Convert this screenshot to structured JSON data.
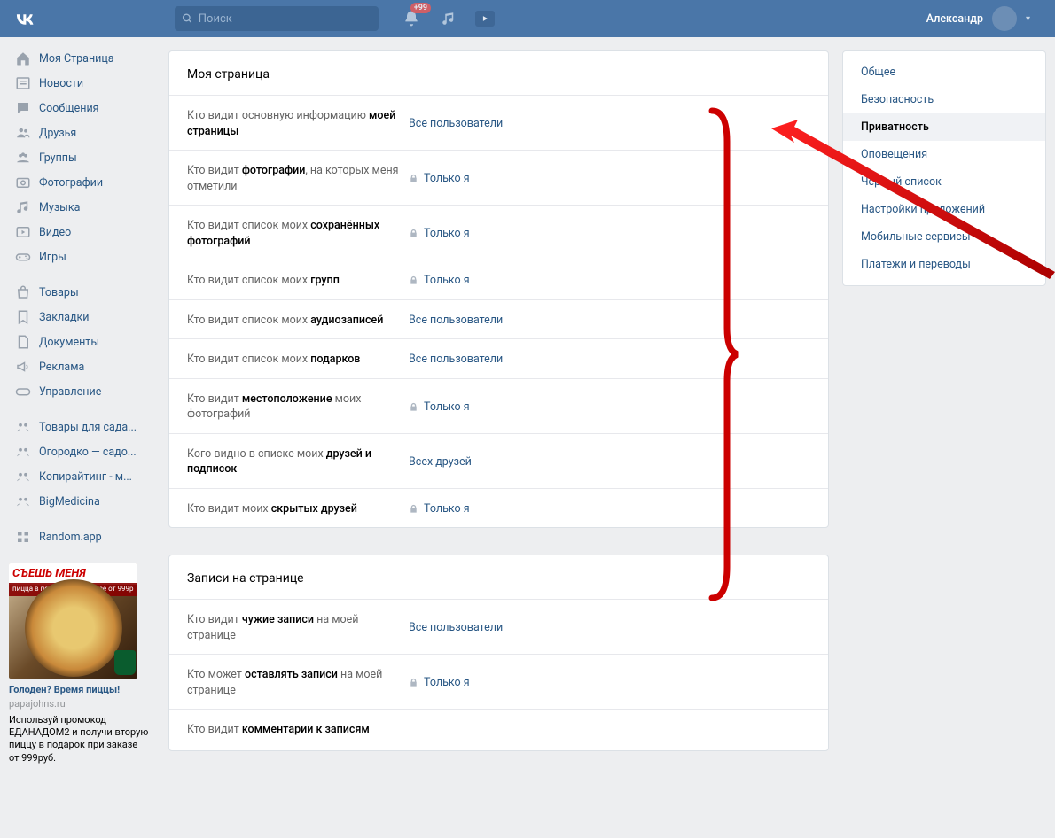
{
  "header": {
    "search_placeholder": "Поиск",
    "notif_badge": "+99",
    "username": "Александр"
  },
  "nav": [
    {
      "label": "Моя Страница",
      "icon": "home"
    },
    {
      "label": "Новости",
      "icon": "news"
    },
    {
      "label": "Сообщения",
      "icon": "chat"
    },
    {
      "label": "Друзья",
      "icon": "friends"
    },
    {
      "label": "Группы",
      "icon": "groups"
    },
    {
      "label": "Фотографии",
      "icon": "photo"
    },
    {
      "label": "Музыка",
      "icon": "music"
    },
    {
      "label": "Видео",
      "icon": "video"
    },
    {
      "label": "Игры",
      "icon": "games"
    },
    {
      "sep": true
    },
    {
      "label": "Товары",
      "icon": "market"
    },
    {
      "label": "Закладки",
      "icon": "bookmark"
    },
    {
      "label": "Документы",
      "icon": "doc"
    },
    {
      "label": "Реклама",
      "icon": "ads"
    },
    {
      "label": "Управление",
      "icon": "manage"
    },
    {
      "sep": true
    },
    {
      "label": "Товары для сада...",
      "icon": "ext"
    },
    {
      "label": "Огородко — садо...",
      "icon": "ext"
    },
    {
      "label": "Копирайтинг - м...",
      "icon": "ext"
    },
    {
      "label": "BigMedicina",
      "icon": "ext"
    },
    {
      "sep": true
    },
    {
      "label": "Random.app",
      "icon": "app"
    }
  ],
  "sections": [
    {
      "title": "Моя страница",
      "rows": [
        {
          "label": "Кто видит основную информацию <b>моей страницы</b>",
          "value": "Все пользователи",
          "lock": false
        },
        {
          "label": "Кто видит <b>фотографии</b>, на которых меня отметили",
          "value": "Только я",
          "lock": true
        },
        {
          "label": "Кто видит список моих <b>сохранённых фотографий</b>",
          "value": "Только я",
          "lock": true
        },
        {
          "label": "Кто видит список моих <b>групп</b>",
          "value": "Только я",
          "lock": true
        },
        {
          "label": "Кто видит список моих <b>аудиозаписей</b>",
          "value": "Все пользователи",
          "lock": false
        },
        {
          "label": "Кто видит список моих <b>подарков</b>",
          "value": "Все пользователи",
          "lock": false
        },
        {
          "label": "Кто видит <b>местоположение</b> моих фотографий",
          "value": "Только я",
          "lock": true
        },
        {
          "label": "Кого видно в списке моих <b>друзей и подписок</b>",
          "value": "Всех друзей",
          "lock": false
        },
        {
          "label": "Кто видит моих <b>скрытых друзей</b>",
          "value": "Только я",
          "lock": true
        }
      ]
    },
    {
      "title": "Записи на странице",
      "rows": [
        {
          "label": "Кто видит <b>чужие записи</b> на моей странице",
          "value": "Все пользователи",
          "lock": false
        },
        {
          "label": "Кто может <b>оставлять записи</b> на моей странице",
          "value": "Только я",
          "lock": true
        },
        {
          "label": "Кто видит <b>комментарии к записям</b>",
          "value": "",
          "lock": false
        }
      ]
    }
  ],
  "side_tabs": [
    {
      "label": "Общее",
      "active": false
    },
    {
      "label": "Безопасность",
      "active": false
    },
    {
      "label": "Приватность",
      "active": true
    },
    {
      "label": "Оповещения",
      "active": false
    },
    {
      "label": "Чёрный список",
      "active": false
    },
    {
      "label": "Настройки приложений",
      "active": false
    },
    {
      "label": "Мобильные сервисы",
      "active": false
    },
    {
      "label": "Платежи и переводы",
      "active": false
    }
  ],
  "ad": {
    "banner": "СЪЕШЬ МЕНЯ",
    "sub": "пицца в подарок при заказе от 999р",
    "title": "Голоден? Время пиццы!",
    "domain": "papajohns.ru",
    "text": "Используй промокод ЕДАНАДОМ2 и получи вторую пиццу в подарок при заказе от 999руб."
  }
}
